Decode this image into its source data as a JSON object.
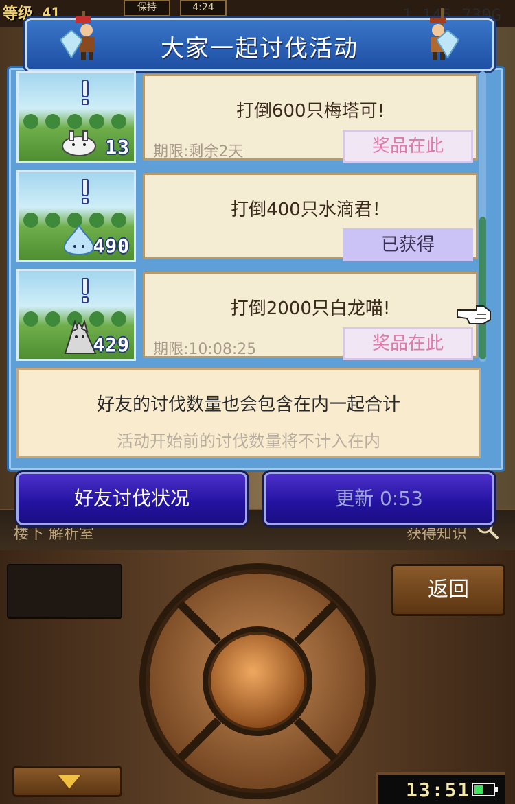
{
  "hud": {
    "level_label": "等级 41",
    "box1": "保持",
    "box2": "4:24",
    "money": "1,145,730G"
  },
  "dialog": {
    "title": "大家一起讨伐活动",
    "quests": [
      {
        "title": "打倒600只梅塔可!",
        "deadline": "期限:剩余2天",
        "count": "13",
        "button_label": "奖品在此",
        "claimed": false,
        "monster": "white-bunny-icon"
      },
      {
        "title": "打倒400只水滴君！",
        "deadline": "",
        "count": "490",
        "button_label": "已获得",
        "claimed": true,
        "monster": "water-drop-icon"
      },
      {
        "title": "打倒2000只白龙喵!",
        "deadline": "期限:10:08:25",
        "count": "429",
        "button_label": "奖品在此",
        "claimed": false,
        "monster": "white-dragon-cat-icon"
      }
    ],
    "info_line1": "好友的讨伐数量也会包含在内一起合计",
    "info_line2": "活动开始前的讨伐数量将不计入在内",
    "btn_friend_status": "好友讨伐状况",
    "btn_update": "更新 0:53"
  },
  "background_bar": {
    "left_text": "楼下 解析室",
    "right_text": "获得知识"
  },
  "controller": {
    "back_label": "返回",
    "clock": "13:51"
  },
  "colors": {
    "dialog_blue": "#5d9fd6",
    "header_blue": "#1e4fa3",
    "card_bg": "#f5ecd4",
    "prize_pink": "#e07aa8",
    "claimed_purple": "#cbc3f6",
    "button_indigo": "#2212a0"
  }
}
